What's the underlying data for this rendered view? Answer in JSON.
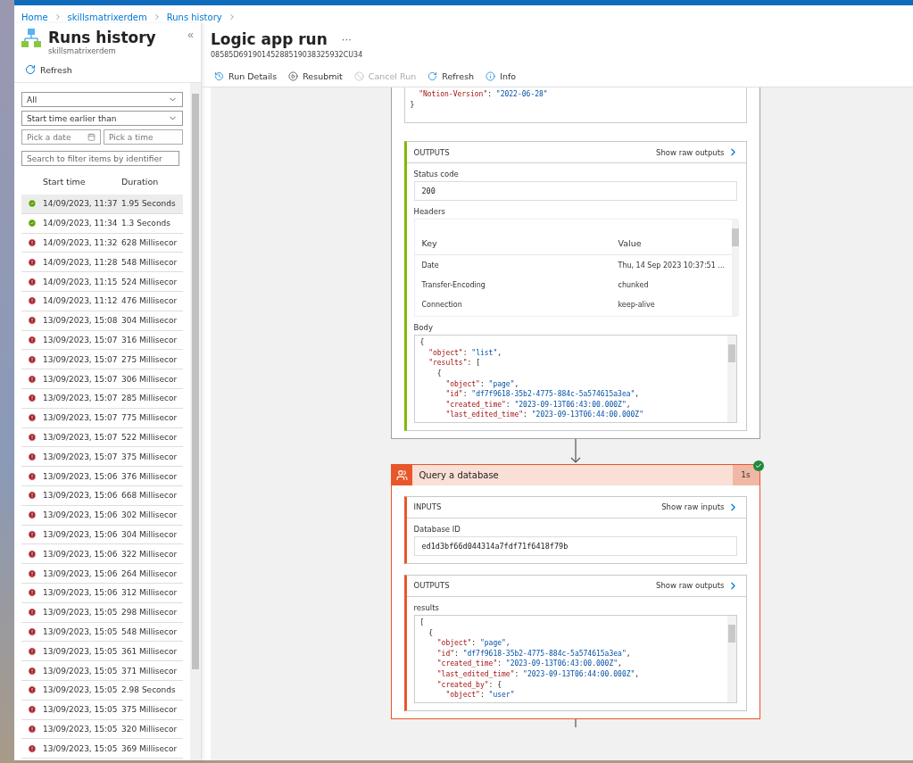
{
  "breadcrumb": [
    "Home",
    "skillsmatrixerdem",
    "Runs history"
  ],
  "sidebar": {
    "title": "Runs history",
    "subtitle": "skillsmatrixerdem",
    "collapse": "«",
    "refresh": "Refresh",
    "status_filter": "All",
    "time_filter": "Start time earlier than",
    "date_placeholder": "Pick a date",
    "time_placeholder": "Pick a time",
    "search_placeholder": "Search to filter items by identifier",
    "columns": [
      "Start time",
      "Duration"
    ],
    "runs": [
      {
        "failed": false,
        "start": "14/09/2023, 11:37",
        "duration": "1.95 Seconds",
        "selected": true
      },
      {
        "failed": false,
        "start": "14/09/2023, 11:34",
        "duration": "1.3 Seconds",
        "selected": false
      },
      {
        "failed": true,
        "start": "14/09/2023, 11:32",
        "duration": "628 Millisecor",
        "selected": false
      },
      {
        "failed": true,
        "start": "14/09/2023, 11:28",
        "duration": "548 Millisecor",
        "selected": false
      },
      {
        "failed": true,
        "start": "14/09/2023, 11:15",
        "duration": "524 Millisecor",
        "selected": false
      },
      {
        "failed": true,
        "start": "14/09/2023, 11:12",
        "duration": "476 Millisecor",
        "selected": false
      },
      {
        "failed": true,
        "start": "13/09/2023, 15:08",
        "duration": "304 Millisecor",
        "selected": false
      },
      {
        "failed": true,
        "start": "13/09/2023, 15:07",
        "duration": "316 Millisecor",
        "selected": false
      },
      {
        "failed": true,
        "start": "13/09/2023, 15:07",
        "duration": "275 Millisecor",
        "selected": false
      },
      {
        "failed": true,
        "start": "13/09/2023, 15:07",
        "duration": "306 Millisecor",
        "selected": false
      },
      {
        "failed": true,
        "start": "13/09/2023, 15:07",
        "duration": "285 Millisecor",
        "selected": false
      },
      {
        "failed": true,
        "start": "13/09/2023, 15:07",
        "duration": "775 Millisecor",
        "selected": false
      },
      {
        "failed": true,
        "start": "13/09/2023, 15:07",
        "duration": "522 Millisecor",
        "selected": false
      },
      {
        "failed": true,
        "start": "13/09/2023, 15:07",
        "duration": "375 Millisecor",
        "selected": false
      },
      {
        "failed": true,
        "start": "13/09/2023, 15:06",
        "duration": "376 Millisecor",
        "selected": false
      },
      {
        "failed": true,
        "start": "13/09/2023, 15:06",
        "duration": "668 Millisecor",
        "selected": false
      },
      {
        "failed": true,
        "start": "13/09/2023, 15:06",
        "duration": "302 Millisecor",
        "selected": false
      },
      {
        "failed": true,
        "start": "13/09/2023, 15:06",
        "duration": "304 Millisecor",
        "selected": false
      },
      {
        "failed": true,
        "start": "13/09/2023, 15:06",
        "duration": "322 Millisecor",
        "selected": false
      },
      {
        "failed": true,
        "start": "13/09/2023, 15:06",
        "duration": "264 Millisecor",
        "selected": false
      },
      {
        "failed": true,
        "start": "13/09/2023, 15:06",
        "duration": "312 Millisecor",
        "selected": false
      },
      {
        "failed": true,
        "start": "13/09/2023, 15:05",
        "duration": "298 Millisecor",
        "selected": false
      },
      {
        "failed": true,
        "start": "13/09/2023, 15:05",
        "duration": "548 Millisecor",
        "selected": false
      },
      {
        "failed": true,
        "start": "13/09/2023, 15:05",
        "duration": "361 Millisecor",
        "selected": false
      },
      {
        "failed": true,
        "start": "13/09/2023, 15:05",
        "duration": "371 Millisecor",
        "selected": false
      },
      {
        "failed": true,
        "start": "13/09/2023, 15:05",
        "duration": "2.98 Seconds",
        "selected": false
      },
      {
        "failed": true,
        "start": "13/09/2023, 15:05",
        "duration": "375 Millisecor",
        "selected": false
      },
      {
        "failed": true,
        "start": "13/09/2023, 15:05",
        "duration": "320 Millisecor",
        "selected": false
      },
      {
        "failed": true,
        "start": "13/09/2023, 15:05",
        "duration": "369 Millisecor",
        "selected": false
      }
    ]
  },
  "run": {
    "title": "Logic app run",
    "more": "···",
    "id": "08585D69190145288519038325932CU34",
    "toolbar": [
      {
        "kind": "details",
        "label": "Run Details",
        "disabled": false
      },
      {
        "kind": "resubmit",
        "label": "Resubmit",
        "disabled": false
      },
      {
        "kind": "cancel",
        "label": "Cancel Run",
        "disabled": true
      },
      {
        "kind": "refresh",
        "label": "Refresh",
        "disabled": false
      },
      {
        "kind": "info",
        "label": "Info",
        "disabled": false
      }
    ]
  },
  "steps": [
    {
      "kind": "partial",
      "color": "#7fba00",
      "inputs_tail": [
        "  \"Notion-Version\": \"2022-06-28\"",
        "}"
      ],
      "sections": [
        {
          "label": "OUTPUTS",
          "raw": "Show raw outputs",
          "fields": [
            {
              "kind": "text",
              "label": "Status code",
              "value": "200"
            },
            {
              "kind": "table",
              "label": "Headers",
              "columns": [
                "Key",
                "Value"
              ],
              "rows": [
                [
                  "Date",
                  "Thu, 14 Sep 2023 10:37:51 ..."
                ],
                [
                  "Transfer-Encoding",
                  "chunked"
                ],
                [
                  "Connection",
                  "keep-alive"
                ]
              ]
            },
            {
              "kind": "code",
              "label": "Body",
              "lines": [
                "{",
                "  \"object\": \"list\",",
                "  \"results\": [",
                "    {",
                "      \"object\": \"page\",",
                "      \"id\": \"df7f9618-35b2-4775-884c-5a574615a3ea\",",
                "      \"created_time\": \"2023-09-13T06:43:00.000Z\",",
                "      \"last_edited_time\": \"2023-09-13T06:44:00.000Z\""
              ]
            }
          ]
        }
      ]
    },
    {
      "kind": "full",
      "color": "#e8572a",
      "title": "Query a database",
      "duration": "1s",
      "succeeded": true,
      "sections": [
        {
          "label": "INPUTS",
          "raw": "Show raw inputs",
          "fields": [
            {
              "kind": "text",
              "label": "Database ID",
              "value": "ed1d3bf66d044314a7fdf71f6418f79b"
            }
          ]
        },
        {
          "label": "OUTPUTS",
          "raw": "Show raw outputs",
          "fields": [
            {
              "kind": "code",
              "label": "results",
              "lines": [
                "[",
                "  {",
                "    \"object\": \"page\",",
                "    \"id\": \"df7f9618-35b2-4775-884c-5a574615a3ea\",",
                "    \"created_time\": \"2023-09-13T06:43:00.000Z\",",
                "    \"last_edited_time\": \"2023-09-13T06:44:00.000Z\",",
                "    \"created_by\": {",
                "      \"object\": \"user\""
              ]
            }
          ]
        }
      ]
    }
  ]
}
